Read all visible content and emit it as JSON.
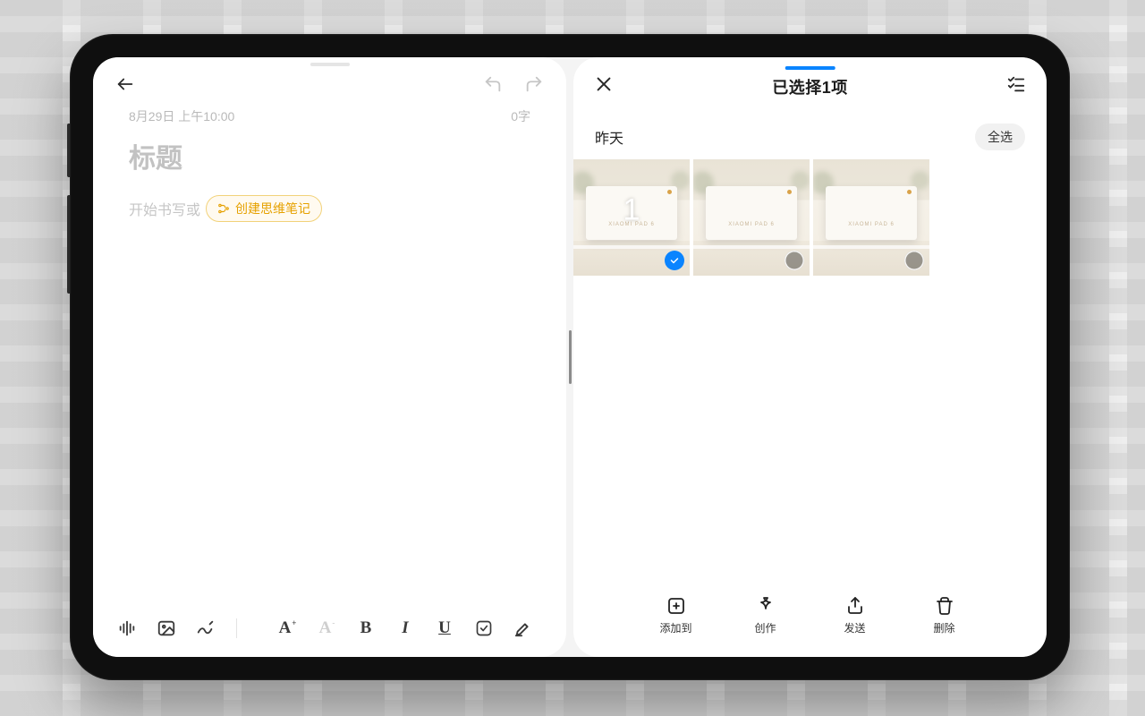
{
  "left": {
    "meta_date": "8月29日 上午10:00",
    "meta_count": "0字",
    "title": "标题",
    "body_placeholder": "开始书写或",
    "chip_label": "创建思维笔记",
    "toolbar": {
      "voice": "voice",
      "image": "image",
      "draw": "draw",
      "font_inc": "A",
      "font_dec": "A",
      "bold": "B",
      "italic": "I",
      "underline": "U",
      "checklist": "check",
      "highlight": "highlight"
    }
  },
  "right": {
    "title": "已选择1项",
    "date_group": "昨天",
    "select_all": "全选",
    "thumbs": [
      {
        "selected": true,
        "overlay_number": "1",
        "brand": "XIAOMI PAD 6"
      },
      {
        "selected": false,
        "overlay_number": "",
        "brand": "XIAOMI PAD 6"
      },
      {
        "selected": false,
        "overlay_number": "",
        "brand": "XIAOMI PAD 6"
      }
    ],
    "actions": {
      "add_to": "添加到",
      "create": "创作",
      "send": "发送",
      "delete": "删除"
    }
  }
}
